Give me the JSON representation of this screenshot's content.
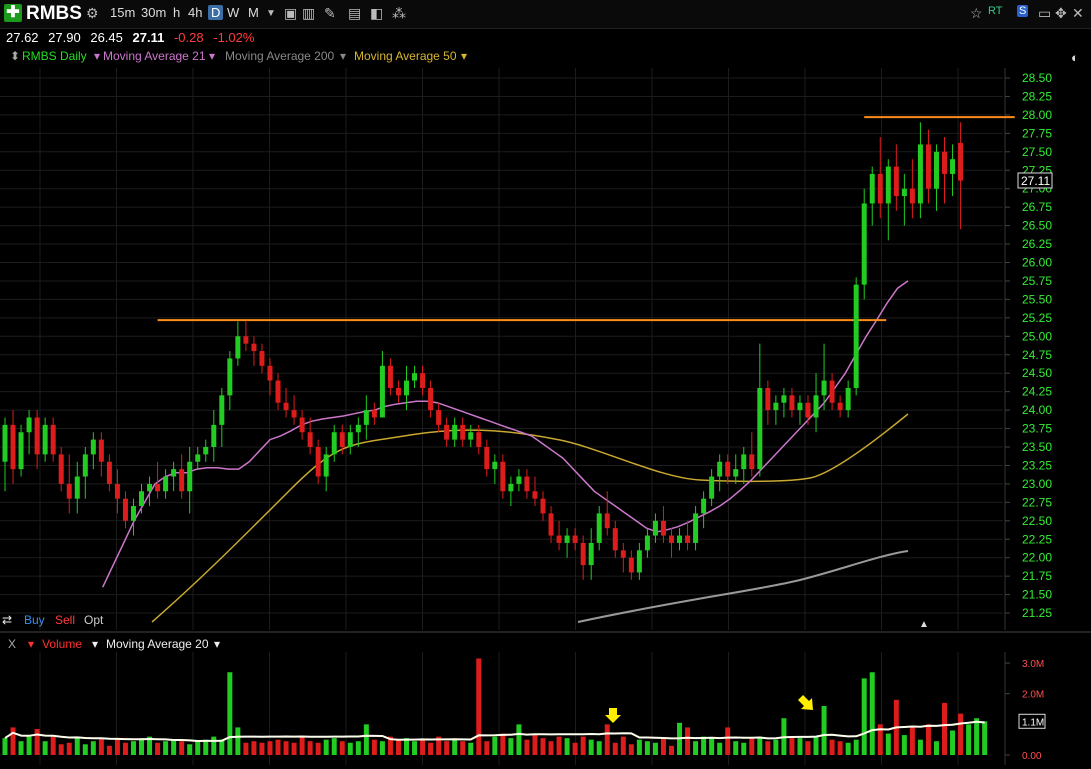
{
  "toolbar": {
    "symbol": "RMBS",
    "timeframes": [
      "15m",
      "30m",
      "h",
      "4h",
      "D",
      "W",
      "M"
    ],
    "active_timeframe": "D"
  },
  "quote": {
    "open": "27.62",
    "high": "27.90",
    "low": "26.45",
    "close": "27.11",
    "change": "-0.28",
    "change_pct": "-1.02%"
  },
  "legend": {
    "main": "RMBS Daily",
    "ma21": "Moving Average 21",
    "ma200": "Moving Average 200",
    "ma50": "Moving Average 50"
  },
  "trade": {
    "buy": "Buy",
    "sell": "Sell",
    "opt": "Opt"
  },
  "volume_legend": {
    "close": "X",
    "volume": "Volume",
    "ma20": "Moving Average 20"
  },
  "colors": {
    "up": "#22cc22",
    "down": "#dd1c1c",
    "ma21": "#cc77cc",
    "ma50": "#c8a830",
    "ma200": "#999999",
    "level": "#ff8c1a",
    "axis_text": "#33ee33",
    "vol_ma": "#ffffee",
    "arrow": "#ffee00"
  },
  "chart_data": [
    {
      "type": "candlestick",
      "title": "RMBS Daily",
      "ylim": [
        21.1,
        28.65
      ],
      "y_ticks": [
        "21.25",
        "21.50",
        "21.75",
        "22.00",
        "22.25",
        "22.50",
        "22.75",
        "23.00",
        "23.25",
        "23.50",
        "23.75",
        "24.00",
        "24.25",
        "24.50",
        "24.75",
        "25.00",
        "25.25",
        "25.50",
        "25.75",
        "26.00",
        "26.25",
        "26.50",
        "26.75",
        "27.00",
        "27.25",
        "27.50",
        "27.75",
        "28.00",
        "28.25",
        "28.50"
      ],
      "last_price_label": "27.11",
      "grid": true,
      "levels": [
        {
          "price": 25.22,
          "from_index": 19,
          "to_index": 109
        },
        {
          "price": 27.97,
          "from_index": 107,
          "to_index": 125
        }
      ],
      "candles": [
        {
          "o": 23.3,
          "h": 23.9,
          "l": 22.9,
          "c": 23.8
        },
        {
          "o": 23.8,
          "h": 24.0,
          "l": 23.0,
          "c": 23.2
        },
        {
          "o": 23.2,
          "h": 23.8,
          "l": 23.1,
          "c": 23.7
        },
        {
          "o": 23.7,
          "h": 24.0,
          "l": 23.4,
          "c": 23.9
        },
        {
          "o": 23.9,
          "h": 24.0,
          "l": 23.2,
          "c": 23.4
        },
        {
          "o": 23.4,
          "h": 23.9,
          "l": 23.3,
          "c": 23.8
        },
        {
          "o": 23.8,
          "h": 23.9,
          "l": 23.3,
          "c": 23.4
        },
        {
          "o": 23.4,
          "h": 23.5,
          "l": 22.9,
          "c": 23.0
        },
        {
          "o": 23.0,
          "h": 23.4,
          "l": 22.6,
          "c": 22.8
        },
        {
          "o": 22.8,
          "h": 23.3,
          "l": 22.6,
          "c": 23.1
        },
        {
          "o": 23.1,
          "h": 23.5,
          "l": 22.8,
          "c": 23.4
        },
        {
          "o": 23.4,
          "h": 23.7,
          "l": 23.2,
          "c": 23.6
        },
        {
          "o": 23.6,
          "h": 23.7,
          "l": 23.1,
          "c": 23.3
        },
        {
          "o": 23.3,
          "h": 23.4,
          "l": 22.9,
          "c": 23.0
        },
        {
          "o": 23.0,
          "h": 23.2,
          "l": 22.6,
          "c": 22.8
        },
        {
          "o": 22.8,
          "h": 22.9,
          "l": 22.4,
          "c": 22.5
        },
        {
          "o": 22.5,
          "h": 22.8,
          "l": 22.3,
          "c": 22.7
        },
        {
          "o": 22.7,
          "h": 23.0,
          "l": 22.6,
          "c": 22.9
        },
        {
          "o": 22.9,
          "h": 23.1,
          "l": 22.7,
          "c": 23.0
        },
        {
          "o": 23.0,
          "h": 23.3,
          "l": 22.8,
          "c": 22.9
        },
        {
          "o": 22.9,
          "h": 23.2,
          "l": 22.8,
          "c": 23.1
        },
        {
          "o": 23.1,
          "h": 23.3,
          "l": 22.9,
          "c": 23.2
        },
        {
          "o": 23.2,
          "h": 23.4,
          "l": 22.8,
          "c": 22.9
        },
        {
          "o": 22.9,
          "h": 23.5,
          "l": 22.6,
          "c": 23.3
        },
        {
          "o": 23.3,
          "h": 23.5,
          "l": 23.2,
          "c": 23.4
        },
        {
          "o": 23.4,
          "h": 23.6,
          "l": 23.3,
          "c": 23.5
        },
        {
          "o": 23.5,
          "h": 24.0,
          "l": 23.3,
          "c": 23.8
        },
        {
          "o": 23.8,
          "h": 24.3,
          "l": 23.5,
          "c": 24.2
        },
        {
          "o": 24.2,
          "h": 24.8,
          "l": 24.0,
          "c": 24.7
        },
        {
          "o": 24.7,
          "h": 25.2,
          "l": 24.6,
          "c": 25.0
        },
        {
          "o": 25.0,
          "h": 25.2,
          "l": 24.8,
          "c": 24.9
        },
        {
          "o": 24.9,
          "h": 25.0,
          "l": 24.6,
          "c": 24.8
        },
        {
          "o": 24.8,
          "h": 24.9,
          "l": 24.5,
          "c": 24.6
        },
        {
          "o": 24.6,
          "h": 24.7,
          "l": 24.2,
          "c": 24.4
        },
        {
          "o": 24.4,
          "h": 24.5,
          "l": 24.0,
          "c": 24.1
        },
        {
          "o": 24.1,
          "h": 24.3,
          "l": 23.9,
          "c": 24.0
        },
        {
          "o": 24.0,
          "h": 24.2,
          "l": 23.8,
          "c": 23.9
        },
        {
          "o": 23.9,
          "h": 24.0,
          "l": 23.6,
          "c": 23.7
        },
        {
          "o": 23.7,
          "h": 23.9,
          "l": 23.4,
          "c": 23.5
        },
        {
          "o": 23.5,
          "h": 23.6,
          "l": 23.0,
          "c": 23.1
        },
        {
          "o": 23.1,
          "h": 23.5,
          "l": 22.9,
          "c": 23.4
        },
        {
          "o": 23.4,
          "h": 23.8,
          "l": 23.3,
          "c": 23.7
        },
        {
          "o": 23.7,
          "h": 23.8,
          "l": 23.4,
          "c": 23.5
        },
        {
          "o": 23.5,
          "h": 23.8,
          "l": 23.4,
          "c": 23.7
        },
        {
          "o": 23.7,
          "h": 23.9,
          "l": 23.5,
          "c": 23.8
        },
        {
          "o": 23.8,
          "h": 24.2,
          "l": 23.6,
          "c": 24.0
        },
        {
          "o": 24.0,
          "h": 24.1,
          "l": 23.8,
          "c": 23.9
        },
        {
          "o": 23.9,
          "h": 24.8,
          "l": 23.9,
          "c": 24.6
        },
        {
          "o": 24.6,
          "h": 24.7,
          "l": 24.2,
          "c": 24.3
        },
        {
          "o": 24.3,
          "h": 24.4,
          "l": 24.1,
          "c": 24.2
        },
        {
          "o": 24.2,
          "h": 24.6,
          "l": 24.0,
          "c": 24.4
        },
        {
          "o": 24.4,
          "h": 24.6,
          "l": 24.3,
          "c": 24.5
        },
        {
          "o": 24.5,
          "h": 24.6,
          "l": 24.2,
          "c": 24.3
        },
        {
          "o": 24.3,
          "h": 24.4,
          "l": 23.9,
          "c": 24.0
        },
        {
          "o": 24.0,
          "h": 24.1,
          "l": 23.7,
          "c": 23.8
        },
        {
          "o": 23.8,
          "h": 23.9,
          "l": 23.5,
          "c": 23.6
        },
        {
          "o": 23.6,
          "h": 23.9,
          "l": 23.5,
          "c": 23.8
        },
        {
          "o": 23.8,
          "h": 23.9,
          "l": 23.5,
          "c": 23.6
        },
        {
          "o": 23.6,
          "h": 23.8,
          "l": 23.5,
          "c": 23.7
        },
        {
          "o": 23.7,
          "h": 23.8,
          "l": 23.4,
          "c": 23.5
        },
        {
          "o": 23.5,
          "h": 23.6,
          "l": 23.1,
          "c": 23.2
        },
        {
          "o": 23.2,
          "h": 23.4,
          "l": 23.0,
          "c": 23.3
        },
        {
          "o": 23.3,
          "h": 23.4,
          "l": 22.8,
          "c": 22.9
        },
        {
          "o": 22.9,
          "h": 23.1,
          "l": 22.7,
          "c": 23.0
        },
        {
          "o": 23.0,
          "h": 23.2,
          "l": 22.9,
          "c": 23.1
        },
        {
          "o": 23.1,
          "h": 23.2,
          "l": 22.8,
          "c": 22.9
        },
        {
          "o": 22.9,
          "h": 23.1,
          "l": 22.7,
          "c": 22.8
        },
        {
          "o": 22.8,
          "h": 22.9,
          "l": 22.5,
          "c": 22.6
        },
        {
          "o": 22.6,
          "h": 22.7,
          "l": 22.2,
          "c": 22.3
        },
        {
          "o": 22.3,
          "h": 22.5,
          "l": 22.1,
          "c": 22.2
        },
        {
          "o": 22.2,
          "h": 22.4,
          "l": 22.0,
          "c": 22.3
        },
        {
          "o": 22.3,
          "h": 22.4,
          "l": 22.1,
          "c": 22.2
        },
        {
          "o": 22.2,
          "h": 22.3,
          "l": 21.7,
          "c": 21.9
        },
        {
          "o": 21.9,
          "h": 22.4,
          "l": 21.7,
          "c": 22.2
        },
        {
          "o": 22.2,
          "h": 22.7,
          "l": 22.1,
          "c": 22.6
        },
        {
          "o": 22.6,
          "h": 22.9,
          "l": 22.3,
          "c": 22.4
        },
        {
          "o": 22.4,
          "h": 22.5,
          "l": 22.0,
          "c": 22.1
        },
        {
          "o": 22.1,
          "h": 22.2,
          "l": 21.8,
          "c": 22.0
        },
        {
          "o": 22.0,
          "h": 22.1,
          "l": 21.7,
          "c": 21.8
        },
        {
          "o": 21.8,
          "h": 22.2,
          "l": 21.7,
          "c": 22.1
        },
        {
          "o": 22.1,
          "h": 22.4,
          "l": 22.0,
          "c": 22.3
        },
        {
          "o": 22.3,
          "h": 22.6,
          "l": 22.2,
          "c": 22.5
        },
        {
          "o": 22.5,
          "h": 22.7,
          "l": 22.2,
          "c": 22.3
        },
        {
          "o": 22.3,
          "h": 22.4,
          "l": 22.0,
          "c": 22.2
        },
        {
          "o": 22.2,
          "h": 22.4,
          "l": 22.1,
          "c": 22.3
        },
        {
          "o": 22.3,
          "h": 22.5,
          "l": 22.1,
          "c": 22.2
        },
        {
          "o": 22.2,
          "h": 22.7,
          "l": 22.1,
          "c": 22.6
        },
        {
          "o": 22.6,
          "h": 22.9,
          "l": 22.4,
          "c": 22.8
        },
        {
          "o": 22.8,
          "h": 23.2,
          "l": 22.7,
          "c": 23.1
        },
        {
          "o": 23.1,
          "h": 23.4,
          "l": 22.9,
          "c": 23.3
        },
        {
          "o": 23.3,
          "h": 23.4,
          "l": 23.0,
          "c": 23.1
        },
        {
          "o": 23.1,
          "h": 23.4,
          "l": 23.0,
          "c": 23.2
        },
        {
          "o": 23.2,
          "h": 23.5,
          "l": 23.0,
          "c": 23.4
        },
        {
          "o": 23.4,
          "h": 23.7,
          "l": 23.1,
          "c": 23.2
        },
        {
          "o": 23.2,
          "h": 24.9,
          "l": 23.1,
          "c": 24.3
        },
        {
          "o": 24.3,
          "h": 24.4,
          "l": 23.8,
          "c": 24.0
        },
        {
          "o": 24.0,
          "h": 24.2,
          "l": 23.8,
          "c": 24.1
        },
        {
          "o": 24.1,
          "h": 24.3,
          "l": 23.9,
          "c": 24.2
        },
        {
          "o": 24.2,
          "h": 24.3,
          "l": 23.9,
          "c": 24.0
        },
        {
          "o": 24.0,
          "h": 24.2,
          "l": 23.8,
          "c": 24.1
        },
        {
          "o": 24.1,
          "h": 24.2,
          "l": 23.8,
          "c": 23.9
        },
        {
          "o": 23.9,
          "h": 24.5,
          "l": 23.7,
          "c": 24.2
        },
        {
          "o": 24.2,
          "h": 24.9,
          "l": 24.0,
          "c": 24.4
        },
        {
          "o": 24.4,
          "h": 24.5,
          "l": 24.0,
          "c": 24.1
        },
        {
          "o": 24.1,
          "h": 24.2,
          "l": 23.9,
          "c": 24.0
        },
        {
          "o": 24.0,
          "h": 24.4,
          "l": 23.9,
          "c": 24.3
        },
        {
          "o": 24.3,
          "h": 25.8,
          "l": 24.2,
          "c": 25.7
        },
        {
          "o": 25.7,
          "h": 27.0,
          "l": 25.5,
          "c": 26.8
        },
        {
          "o": 26.8,
          "h": 27.3,
          "l": 26.5,
          "c": 27.2
        },
        {
          "o": 27.2,
          "h": 27.7,
          "l": 26.6,
          "c": 26.8
        },
        {
          "o": 26.8,
          "h": 27.4,
          "l": 26.3,
          "c": 27.3
        },
        {
          "o": 27.3,
          "h": 27.6,
          "l": 26.7,
          "c": 26.9
        },
        {
          "o": 26.9,
          "h": 27.2,
          "l": 26.5,
          "c": 27.0
        },
        {
          "o": 27.0,
          "h": 27.4,
          "l": 26.6,
          "c": 26.8
        },
        {
          "o": 26.8,
          "h": 27.9,
          "l": 26.6,
          "c": 27.6
        },
        {
          "o": 27.6,
          "h": 27.8,
          "l": 26.8,
          "c": 27.0
        },
        {
          "o": 27.0,
          "h": 27.6,
          "l": 26.7,
          "c": 27.5
        },
        {
          "o": 27.5,
          "h": 27.7,
          "l": 26.8,
          "c": 27.2
        },
        {
          "o": 27.2,
          "h": 27.6,
          "l": 26.9,
          "c": 27.4
        },
        {
          "o": 27.62,
          "h": 27.9,
          "l": 26.45,
          "c": 27.11
        }
      ],
      "series": [
        {
          "name": "Moving Average 21",
          "values": [
            null,
            null,
            null,
            null,
            null,
            null,
            21.6,
            21.9,
            22.2,
            22.5,
            22.75,
            23.0,
            23.1,
            23.15,
            23.15,
            23.2,
            23.22,
            23.22,
            23.2,
            23.2,
            23.3,
            23.45,
            23.6,
            23.65,
            23.72,
            23.8,
            23.85,
            23.88,
            23.9,
            23.92,
            23.95,
            23.98,
            24.0,
            24.05,
            24.08,
            24.1,
            24.12,
            24.12,
            24.1,
            24.05,
            24.0,
            23.95,
            23.9,
            23.85,
            23.8,
            23.75,
            23.7,
            23.65,
            23.55,
            23.45,
            23.35,
            23.2,
            23.05,
            22.9,
            22.8,
            22.7,
            22.6,
            22.5,
            22.4,
            22.35,
            22.38,
            22.42,
            22.48,
            22.55,
            22.62,
            22.7,
            22.8,
            22.92,
            23.05,
            23.2,
            23.35,
            23.5,
            23.65,
            23.8,
            23.95,
            24.1,
            24.3,
            24.5,
            24.75,
            25.0,
            25.22,
            25.45,
            25.65,
            25.75
          ]
        },
        {
          "name": "Moving Average 50",
          "values": []
        },
        {
          "name": "Moving Average 200",
          "values": []
        }
      ]
    },
    {
      "type": "bar",
      "title": "Volume",
      "y_ticks": [
        "0.00",
        "1.1M",
        "2.0M",
        "3.0M"
      ],
      "ylim": [
        0,
        3.1
      ],
      "unit": "M",
      "values": [
        0.55,
        0.9,
        0.45,
        0.6,
        0.85,
        0.45,
        0.6,
        0.35,
        0.4,
        0.6,
        0.35,
        0.45,
        0.55,
        0.3,
        0.5,
        0.4,
        0.45,
        0.55,
        0.6,
        0.4,
        0.45,
        0.5,
        0.45,
        0.35,
        0.45,
        0.5,
        0.6,
        0.5,
        2.7,
        0.9,
        0.4,
        0.45,
        0.4,
        0.45,
        0.5,
        0.45,
        0.4,
        0.6,
        0.45,
        0.4,
        0.5,
        0.55,
        0.45,
        0.4,
        0.45,
        1.0,
        0.5,
        0.45,
        0.6,
        0.5,
        0.55,
        0.45,
        0.5,
        0.4,
        0.6,
        0.45,
        0.5,
        0.45,
        0.4,
        3.15,
        0.45,
        0.6,
        0.7,
        0.55,
        1.0,
        0.5,
        0.7,
        0.55,
        0.45,
        0.6,
        0.55,
        0.4,
        0.6,
        0.5,
        0.45,
        1.0,
        0.4,
        0.6,
        0.35,
        0.5,
        0.45,
        0.4,
        0.55,
        0.3,
        1.05,
        0.9,
        0.45,
        0.6,
        0.55,
        0.4,
        0.9,
        0.45,
        0.4,
        0.55,
        0.6,
        0.45,
        0.5,
        1.2,
        0.55,
        0.55,
        0.45,
        0.6,
        1.6,
        0.5,
        0.45,
        0.4,
        0.5,
        2.5,
        2.7,
        1.0,
        0.7,
        1.8,
        0.65,
        0.9,
        0.5,
        1.0,
        0.45,
        1.7,
        0.8,
        1.35,
        1.0,
        1.2,
        1.1
      ]
    }
  ]
}
